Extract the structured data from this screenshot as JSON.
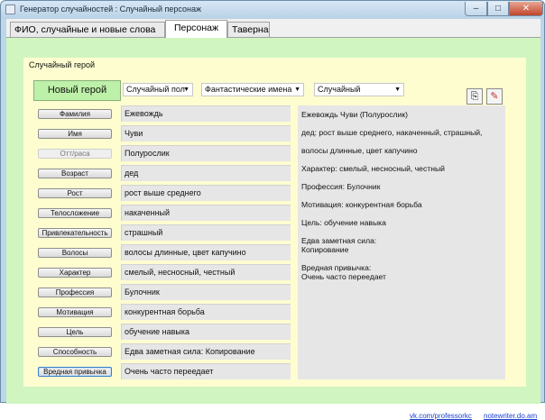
{
  "window": {
    "title": "Генератор случайностей : Случайный персонаж",
    "min_label": "–",
    "max_label": "□",
    "close_label": "✕"
  },
  "tabs": [
    {
      "label": "ФИО, случайные и новые слова"
    },
    {
      "label": "Персонаж"
    },
    {
      "label": "Таверна"
    }
  ],
  "group": {
    "label": "Случайный герой"
  },
  "new_hero_button": "Новый герой",
  "dropdowns": {
    "gender": {
      "value": "Случайный пол"
    },
    "names": {
      "value": "Фантастические имена"
    },
    "mode": {
      "value": "Случайный"
    }
  },
  "tools": {
    "copy_icon": "⎘",
    "edit_icon": "✎"
  },
  "rows": [
    {
      "button": "Фамилия",
      "value": "Ежевождь"
    },
    {
      "button": "Имя",
      "value": "Чуви"
    },
    {
      "button": "Отт/раса",
      "value": "Полурослик"
    },
    {
      "button": "Возраст",
      "value": "дед"
    },
    {
      "button": "Рост",
      "value": "рост выше среднего"
    },
    {
      "button": "Телосложение",
      "value": "накаченный"
    },
    {
      "button": "Привлекательность",
      "value": "страшный"
    },
    {
      "button": "Волосы",
      "value": "волосы длинные, цвет капучино"
    },
    {
      "button": "Характер",
      "value": "смелый, несносный, честный"
    },
    {
      "button": "Профессия",
      "value": "Булочник"
    },
    {
      "button": "Мотивация",
      "value": "конкурентная борьба"
    },
    {
      "button": "Цель",
      "value": "обучение навыка"
    },
    {
      "button": "Способность",
      "value": "Едва заметная сила: Копирование"
    },
    {
      "button": "Вредная привычка",
      "value": "Очень часто переедает"
    }
  ],
  "summary": [
    "Ежевождь Чуви  (Полурослик)",
    "дед: рост выше среднего, накаченный, страшный,",
    "волосы длинные, цвет капучино",
    "Характер: смелый, несносный, честный",
    "Профессия: Булочник",
    "Мотивация: конкурентная борьба",
    "Цель: обучение навыка",
    "Едва заметная сила:\nКопирование",
    "Вредная привычка:\nОчень часто переедает"
  ],
  "links": {
    "left": "vk.com/professorkc",
    "right": "notewriter.do.am"
  },
  "colors": {
    "page_bg": "#d0f5c0",
    "panel_bg": "#fdfdd0",
    "new_hero_bg": "#bdf0a8",
    "link": "#1a3fd0"
  }
}
